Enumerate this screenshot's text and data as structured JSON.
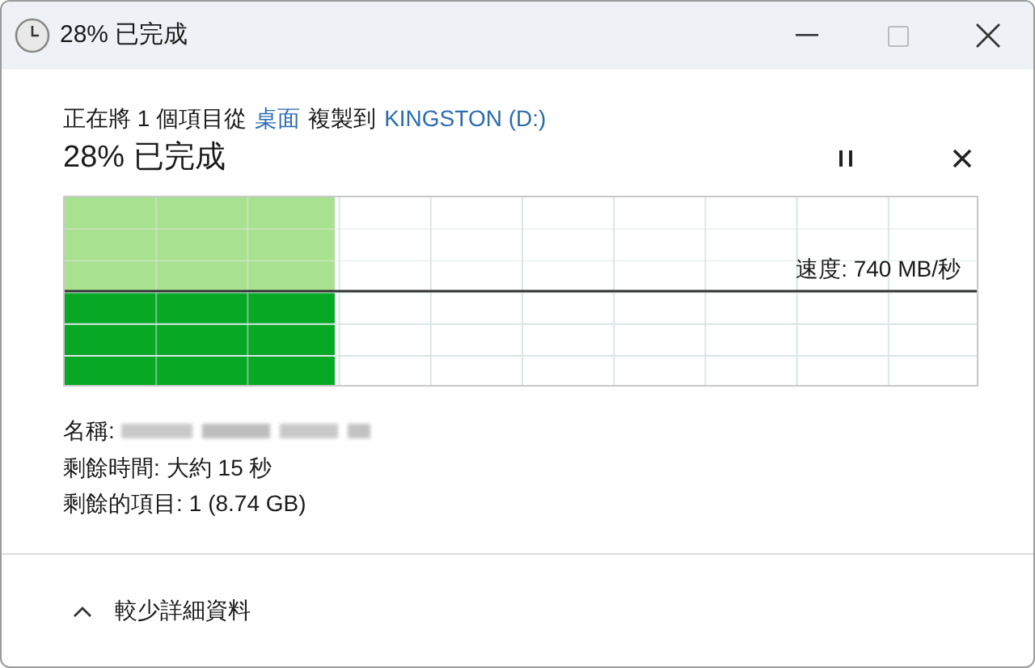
{
  "window": {
    "title": "28% 已完成"
  },
  "status": {
    "prefix": "正在將 1 個項目從",
    "source": "桌面",
    "middle": "複製到",
    "destination": "KINGSTON (D:)"
  },
  "progress": {
    "heading": "28% 已完成",
    "level": 0.295,
    "speed": "速度: 740 MB/秒"
  },
  "details": [
    {
      "kind": "redacted",
      "label": "名稱:"
    },
    {
      "kind": "text",
      "label": "剩餘時間:",
      "value": "大約 15 秒"
    },
    {
      "kind": "text",
      "label": "剩餘的項目:",
      "value": "1 (8.74 GB)"
    }
  ],
  "toggle": {
    "label": "較少詳細資料",
    "expanded": true
  }
}
